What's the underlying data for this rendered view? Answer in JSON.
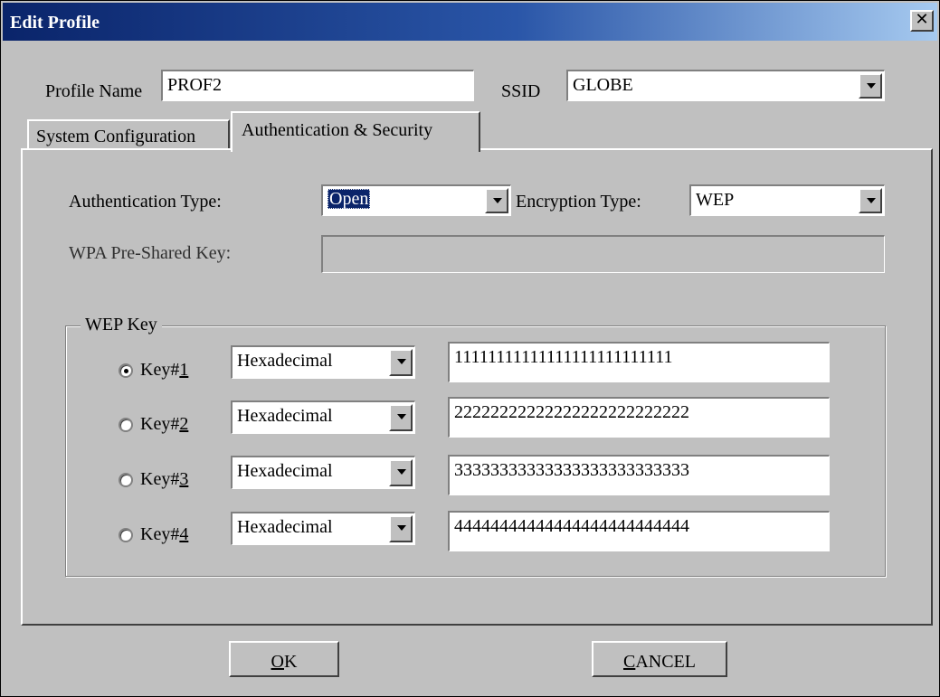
{
  "window": {
    "title": "Edit Profile",
    "close_glyph": "✕"
  },
  "profile": {
    "name_label": "Profile Name",
    "name_value": "PROF2",
    "ssid_label": "SSID",
    "ssid_value": "GLOBE"
  },
  "tabs": [
    {
      "label": "System Configuration",
      "active": false
    },
    {
      "label": "Authentication & Security",
      "active": true
    }
  ],
  "auth": {
    "auth_type_label": "Authentication Type:",
    "auth_type_value": "Open",
    "encryption_label": "Encryption Type:",
    "encryption_value": "WEP",
    "psk_label": "WPA Pre-Shared Key:",
    "psk_value": ""
  },
  "wep": {
    "group_label": "WEP Key",
    "keys": [
      {
        "label_prefix": "Key#",
        "label_accel": "1",
        "format": "Hexadecimal",
        "value": "11111111111111111111111111",
        "selected": true
      },
      {
        "label_prefix": "Key#",
        "label_accel": "2",
        "format": "Hexadecimal",
        "value": "22222222222222222222222222",
        "selected": false
      },
      {
        "label_prefix": "Key#",
        "label_accel": "3",
        "format": "Hexadecimal",
        "value": "33333333333333333333333333",
        "selected": false
      },
      {
        "label_prefix": "Key#",
        "label_accel": "4",
        "format": "Hexadecimal",
        "value": "44444444444444444444444444",
        "selected": false
      }
    ]
  },
  "buttons": {
    "ok_accel": "O",
    "ok_rest": "K",
    "cancel_accel": "C",
    "cancel_rest": "ANCEL"
  },
  "icons": {
    "close": "close-icon",
    "dropdown": "chevron-down-icon"
  }
}
